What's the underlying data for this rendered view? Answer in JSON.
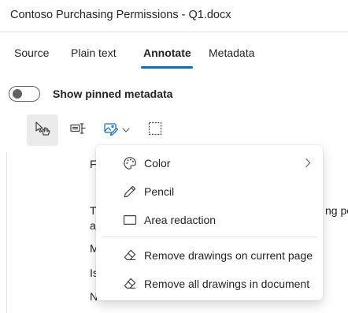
{
  "window": {
    "title": "Contoso Purchasing Permissions - Q1.docx"
  },
  "tabs": [
    {
      "label": "Source"
    },
    {
      "label": "Plain text"
    },
    {
      "label": "Annotate"
    },
    {
      "label": "Metadata"
    }
  ],
  "active_tab": "Annotate",
  "pinned_toggle": {
    "label": "Show pinned metadata",
    "state": "off"
  },
  "toolbar": {
    "tools": [
      {
        "icon": "hand-select-icon",
        "state": "pressed"
      },
      {
        "icon": "text-redaction-icon"
      },
      {
        "icon": "image-edit-icon",
        "has_dropdown": true
      },
      {
        "icon": "area-select-icon"
      }
    ]
  },
  "document": {
    "fragments": [
      "Fo",
      "Th",
      "ng pe",
      "ac",
      "M",
      "Is",
      "N"
    ]
  },
  "drawing_menu": {
    "items": [
      {
        "label": "Color",
        "icon": "palette-icon",
        "has_submenu": true
      },
      {
        "label": "Pencil",
        "icon": "pencil-icon"
      },
      {
        "label": "Area redaction",
        "icon": "rectangle-icon"
      },
      {
        "label": "Remove drawings on current page",
        "icon": "eraser-icon"
      },
      {
        "label": "Remove all drawings in document",
        "icon": "eraser-icon"
      }
    ]
  },
  "colors": {
    "accent": "#0f6cbd",
    "pressed_bg": "#ebebeb",
    "icon": "#424242"
  }
}
